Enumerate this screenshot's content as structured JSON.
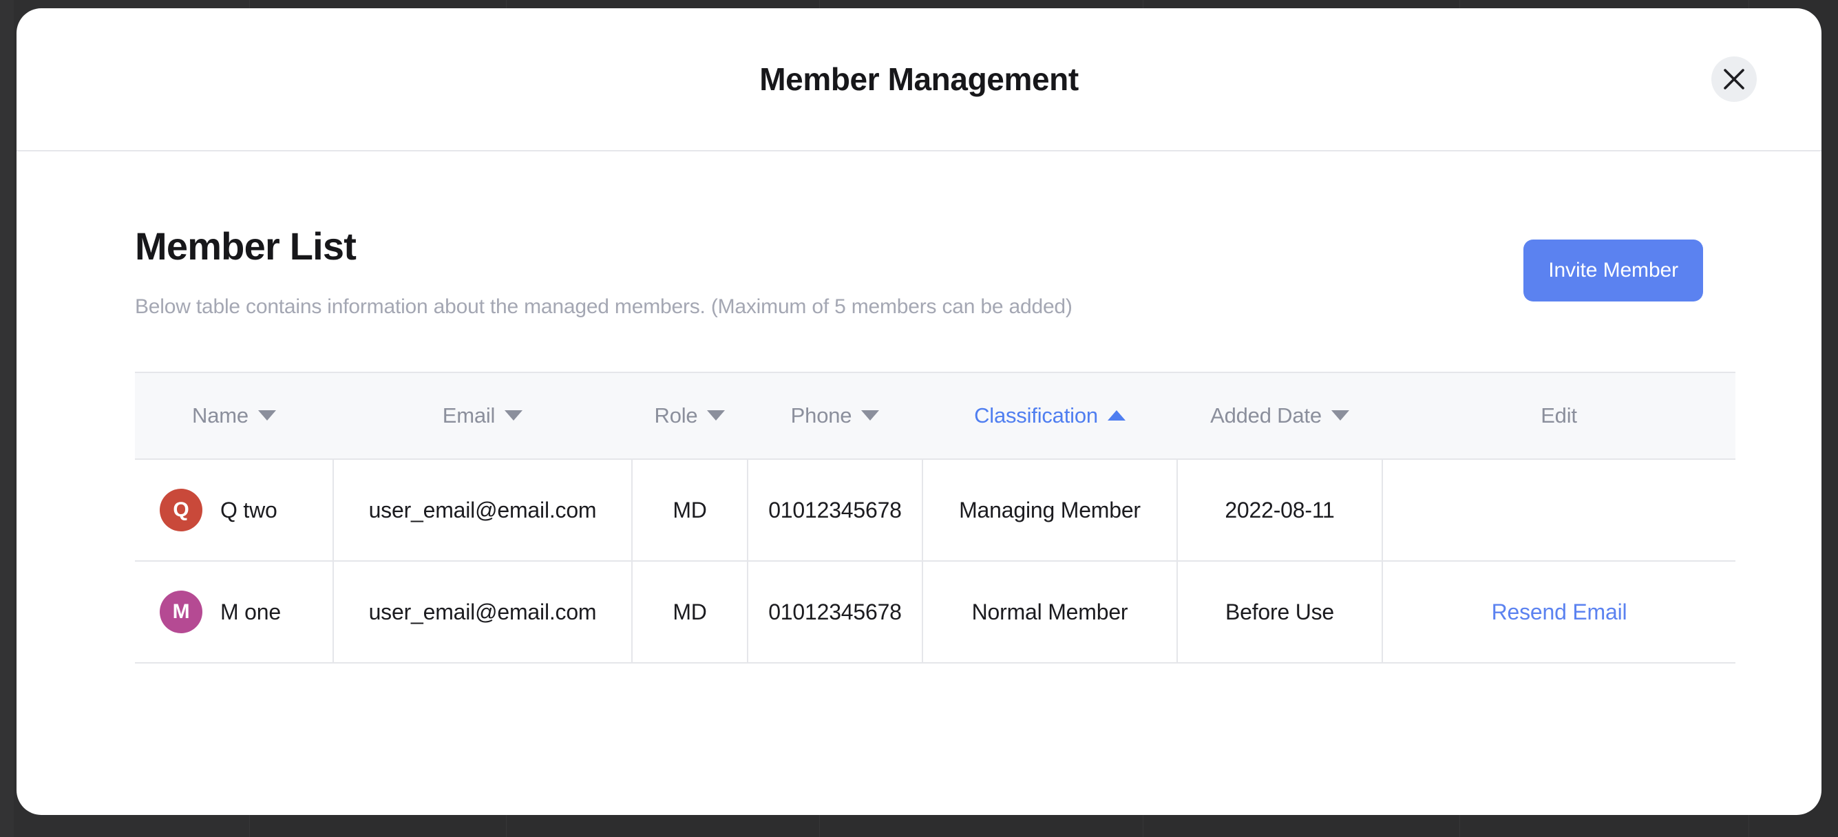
{
  "theme": {
    "accent": "#5b82f0",
    "sort_active": "#4f7ef0",
    "backdrop": "#2d2d2e",
    "header_bg": "#f7f8fa",
    "border": "#e5e6ea",
    "muted_text": "#a4a7b3"
  },
  "modal": {
    "title": "Member Management",
    "close_icon": "close-icon",
    "close_label": "Close"
  },
  "list": {
    "title": "Member List",
    "subtitle": "Below table contains information about the managed members. (Maximum of 5 members can be added)",
    "invite_button": "Invite Member"
  },
  "table": {
    "columns": [
      {
        "label": "Name",
        "sortable": true,
        "sort": "down",
        "active": false
      },
      {
        "label": "Email",
        "sortable": true,
        "sort": "down",
        "active": false
      },
      {
        "label": "Role",
        "sortable": true,
        "sort": "down",
        "active": false
      },
      {
        "label": "Phone",
        "sortable": true,
        "sort": "down",
        "active": false
      },
      {
        "label": "Classification",
        "sortable": true,
        "sort": "up",
        "active": true
      },
      {
        "label": "Added Date",
        "sortable": true,
        "sort": "down",
        "active": false
      },
      {
        "label": "Edit",
        "sortable": false,
        "sort": "",
        "active": false
      }
    ],
    "rows": [
      {
        "avatar_initial": "Q",
        "avatar_color": "#c9493a",
        "name": "Q two",
        "email": "user_email@email.com",
        "role": "MD",
        "phone": "01012345678",
        "classification": "Managing Member",
        "added_date": "2022-08-11",
        "edit": ""
      },
      {
        "avatar_initial": "M",
        "avatar_color": "#b54a93",
        "name": "M one",
        "email": "user_email@email.com",
        "role": "MD",
        "phone": "01012345678",
        "classification": "Normal Member",
        "added_date": "Before Use",
        "edit": "Resend Email"
      }
    ]
  }
}
